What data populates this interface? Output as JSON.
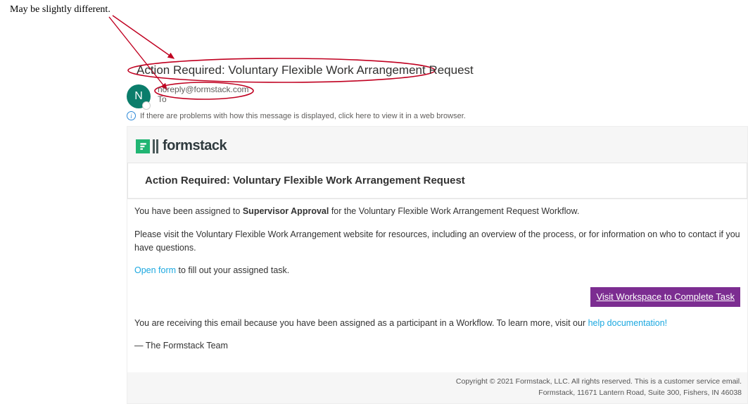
{
  "annotation": {
    "note": "May be slightly different."
  },
  "email": {
    "subject": "Action Required: Voluntary Flexible Work Arrangement Request",
    "avatar_initial": "N",
    "sender": "noreply@formstack.com",
    "to_label": "To",
    "info_bar": "If there are problems with how this message is displayed, click here to view it in a web browser."
  },
  "brand": {
    "name": "formstack"
  },
  "message": {
    "title": "Action Required: Voluntary Flexible Work Arrangement Request",
    "p1_a": "You have been assigned to ",
    "p1_b": "Supervisor Approval",
    "p1_c": " for the Voluntary Flexible Work Arrangement Request Workflow.",
    "p2": "Please visit the Voluntary Flexible Work Arrangement website for resources, including an overview of the process, or for information on who to contact if you have questions.",
    "open_form": "Open form",
    "p3_rest": " to fill out your assigned task.",
    "cta": "Visit Workspace to Complete Task",
    "p4_a": "You are receiving this email because you have been assigned as a participant in a Workflow. To learn more, visit our ",
    "p4_link": "help documentation!",
    "signoff": "— The Formstack Team"
  },
  "footer": {
    "line1": "Copyright © 2021 Formstack, LLC. All rights reserved. This is a customer service email.",
    "line2": "Formstack, 11671 Lantern Road, Suite 300, Fishers, IN 46038"
  }
}
